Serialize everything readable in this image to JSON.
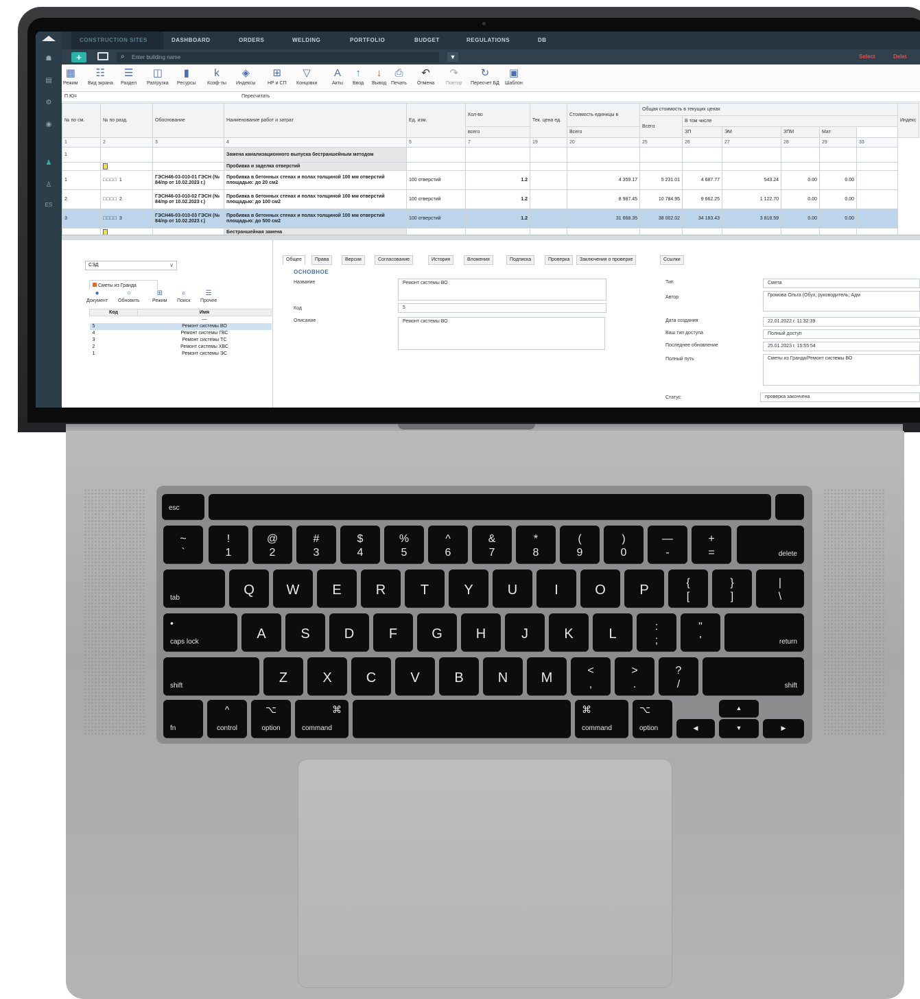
{
  "app": {
    "nav_tabs": [
      "CONSTRUCTION SITES",
      "DASHBOARD",
      "ORDERS",
      "WELDING",
      "PORTFOLIO",
      "BUDGET",
      "REGULATIONS",
      "DB"
    ],
    "search_placeholder": "Enter building name",
    "select_label": "Select",
    "delete_label": "Delet",
    "toolbar": [
      "Режим",
      "Вид экрана",
      "Раздел",
      "Разгрузка",
      "Ресурсы",
      "Коэф-ты",
      "Индексы",
      "НР и СП",
      "Концовки",
      "Акты",
      "Ввод",
      "Вывод",
      "Печать",
      "Отмена",
      "Повтор",
      "Пересчет БД",
      "Шаблон"
    ],
    "formula_label": "П Ю=",
    "recalc_label": "Пересчитать",
    "table": {
      "headers": {
        "c1": "№ по см.",
        "c2": "№ по разд.",
        "c3": "Обоснование",
        "c4": "Наименование работ и затрат",
        "c5": "Ед. изм.",
        "c6": "Кол-во",
        "c6b": "всего",
        "c7": "Тек. цена ед.",
        "c8": "Стоимость единицы в",
        "c8b": "Всего",
        "c9": "Общая стоимость в текущих ценах",
        "c9a": "Всего",
        "c9b": "В том числе",
        "c9c": "ЗП",
        "c9d": "ЭМ",
        "c9e": "ЗПМ",
        "c9f": "Мат",
        "c10": "Индекс"
      },
      "numbers": [
        "1",
        "2",
        "3",
        "4",
        "5",
        "7",
        "19",
        "20",
        "25",
        "26",
        "27",
        "28",
        "29",
        "33"
      ],
      "rows": [
        {
          "a": "1",
          "name": "Замена канализационного выпуска бестраншейным методом"
        },
        {
          "name": "Пробивка и заделка отверстий"
        },
        {
          "a": "1",
          "b": "□□□□ 1",
          "code": "ГЭСН46-03-010-01 ГЭСН (№ 84/пр от 10.02.2023 г.)",
          "name": "Пробивка в бетонных стенах и полах толщиной 100 мм отверстий площадью: до 20 см2",
          "unit": "100 отверстий",
          "qty": "1.2",
          "price": "4 359.17",
          "total": "5 231.01",
          "zp": "4 687.77",
          "em": "543.24",
          "zpm": "0.00",
          "mat": "0.00"
        },
        {
          "a": "2",
          "b": "□□□□ 2",
          "code": "ГЭСН46-03-010-02 ГЭСН (№ 84/пр от 10.02.2023 г.)",
          "name": "Пробивка в бетонных стенах и полах толщиной 100 мм отверстий площадью: до 100 см2",
          "unit": "100 отверстий",
          "qty": "1.2",
          "price": "8 987.45",
          "total": "10 784.95",
          "zp": "9 662.25",
          "em": "1 122.70",
          "zpm": "0.00",
          "mat": "0.00"
        },
        {
          "a": "3",
          "b": "□□□□ 3",
          "code": "ГЭСН46-03-010-03 ГЭСН (№ 84/пр от 10.02.2023 г.)",
          "name": "Пробивка в бетонных стенах и полах толщиной 100 мм отверстий площадью: до 500 см2",
          "unit": "100 отверстий",
          "qty": "1.2",
          "price": "31 668.35",
          "total": "38 002.02",
          "zp": "34 183.43",
          "em": "3 818.59",
          "zpm": "0.00",
          "mat": "0.00"
        },
        {
          "name": "Бестраншейная замена"
        }
      ]
    },
    "lower_left": {
      "combo_value": "СЭД",
      "tab_label": "Сметы из Гранда",
      "tools": [
        "Документ",
        "Обновить",
        "Режим",
        "Поиск",
        "Прочее"
      ],
      "col_code": "Код",
      "col_name": "Имя",
      "items": [
        {
          "code": "5",
          "name": "Ремонт системы ВО"
        },
        {
          "code": "4",
          "name": "Ремонт системы ГВС"
        },
        {
          "code": "3",
          "name": "Ремонт системы ТС"
        },
        {
          "code": "2",
          "name": "Ремонт системы ХВС"
        },
        {
          "code": "1",
          "name": "Ремонт системы ЭС"
        }
      ]
    },
    "details": {
      "tabs": [
        "Общее",
        "Права",
        "Версии",
        "Согласование",
        "История",
        "Вложения",
        "Подписка",
        "Проверка",
        "Заключения о проверке",
        "Ссылки"
      ],
      "section": "ОСНОВНОЕ",
      "name_label": "Название",
      "name_value": "Ремонт системы ВО",
      "code_label": "Код",
      "code_value": "5",
      "desc_label": "Описание",
      "desc_value": "Ремонт системы ВО",
      "type_label": "Тип",
      "type_value": "Смета",
      "author_label": "Автор",
      "author_value": "Громова Ольга (Обух, руководитель; Адм",
      "created_label": "Дата создания",
      "created_value": "22.01.2022 г. 11:32:39",
      "access_label": "Ваш тип доступа",
      "access_value": "Полный доступ",
      "updated_label": "Последнее обновление",
      "updated_value": "25.01.2023 г. 15:55:54",
      "path_label": "Полный путь",
      "path_value": "Сметы из Гранда/Ремонт системы ВО",
      "status_label": "Статус:",
      "status_value": "проверка закончена"
    }
  },
  "keyboard": {
    "esc": "esc",
    "num_top": [
      "~",
      "!",
      "@",
      "#",
      "$",
      "%",
      "^",
      "&",
      "*",
      "(",
      ")",
      "—",
      "+"
    ],
    "num_bot": [
      "`",
      "1",
      "2",
      "3",
      "4",
      "5",
      "6",
      "7",
      "8",
      "9",
      "0",
      "-",
      "="
    ],
    "delete": "delete",
    "tab": "tab",
    "row_q": [
      "Q",
      "W",
      "E",
      "R",
      "T",
      "Y",
      "U",
      "I",
      "O",
      "P"
    ],
    "brace_top": [
      "{",
      "}",
      "|"
    ],
    "brace_bot": [
      "[",
      "]",
      "\\"
    ],
    "caps": "caps lock",
    "row_a": [
      "A",
      "S",
      "D",
      "F",
      "G",
      "H",
      "J",
      "K",
      "L"
    ],
    "colon_top": [
      ":",
      "\""
    ],
    "colon_bot": [
      ";",
      "'"
    ],
    "return": "return",
    "shift": "shift",
    "row_z": [
      "Z",
      "X",
      "C",
      "V",
      "B",
      "N",
      "M"
    ],
    "lt_top": [
      "<",
      ">",
      "?"
    ],
    "lt_bot": [
      ",",
      ".",
      "/"
    ],
    "fn": "fn",
    "control": "control",
    "option": "option",
    "command": "command"
  }
}
